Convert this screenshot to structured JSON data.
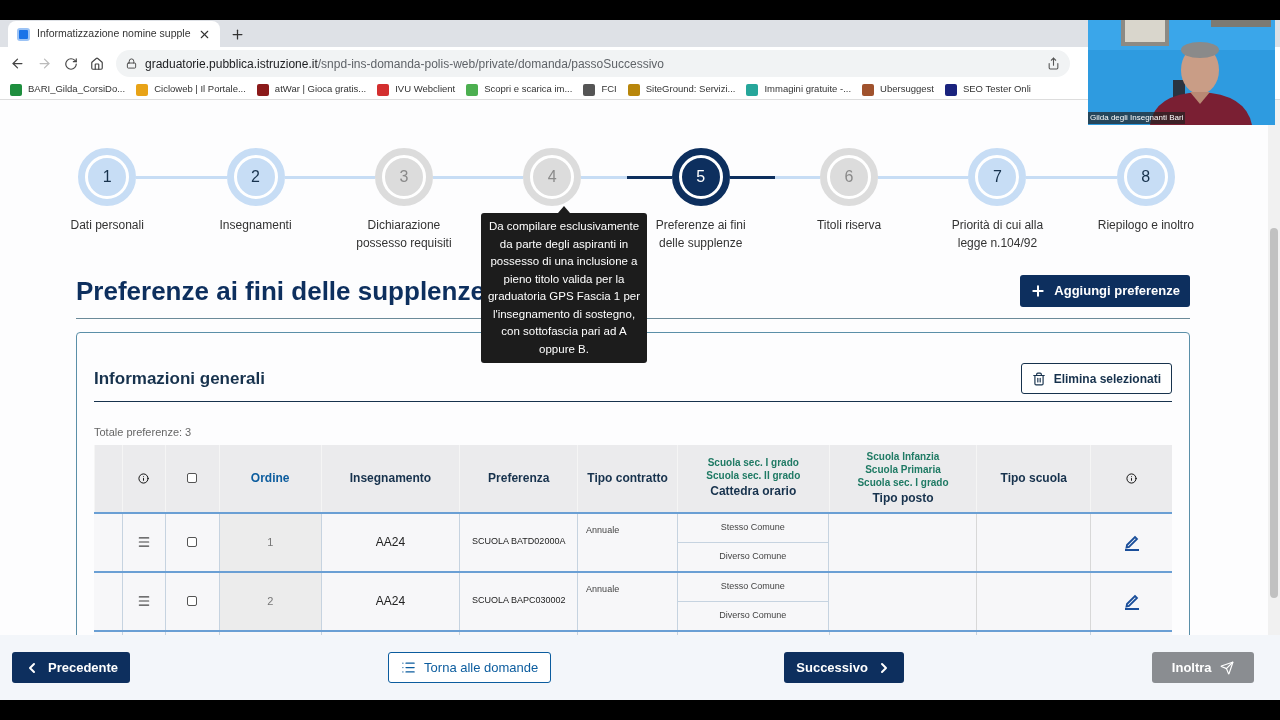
{
  "browser": {
    "tab": {
      "title": "Informatizzazione nomine supple"
    },
    "address": {
      "host": "graduatorie.pubblica.istruzione.it",
      "path": "/snpd-ins-domanda-polis-web/private/domanda/passoSuccessivo"
    },
    "bookmarks": [
      {
        "label": "BARI_Gilda_CorsiDo...",
        "color": "#1e8e3e"
      },
      {
        "label": "Cicloweb | Il Portale...",
        "color": "#e8a317"
      },
      {
        "label": "atWar | Gioca gratis...",
        "color": "#8b1a1a"
      },
      {
        "label": "IVU Webclient",
        "color": "#d32f2f"
      },
      {
        "label": "Scopri e scarica im...",
        "color": "#4caf50"
      },
      {
        "label": "FCI",
        "color": "#555555"
      },
      {
        "label": "SiteGround: Servizi...",
        "color": "#b8860b"
      },
      {
        "label": "Immagini gratuite -...",
        "color": "#26a69a"
      },
      {
        "label": "Ubersuggest",
        "color": "#a0522d"
      },
      {
        "label": "SEO Tester Onli",
        "color": "#1a237e"
      }
    ]
  },
  "webcam": {
    "caption": "Gilda degli Insegnanti Bari"
  },
  "stepper": [
    {
      "number": "1",
      "label": "Dati personali",
      "selected": false,
      "disabled": false
    },
    {
      "number": "2",
      "label": "Insegnamenti",
      "selected": false,
      "disabled": false
    },
    {
      "number": "3",
      "label": "Dichiarazione possesso requisiti",
      "selected": false,
      "disabled": true
    },
    {
      "number": "4",
      "selected": false,
      "disabled": true
    },
    {
      "number": "5",
      "label": "Preferenze ai fini delle supplenze",
      "selected": true,
      "disabled": false
    },
    {
      "number": "6",
      "label": "Titoli riserva",
      "selected": false,
      "disabled": true
    },
    {
      "number": "7",
      "label": "Priorità di cui alla legge n.104/92",
      "selected": false,
      "disabled": false
    },
    {
      "number": "8",
      "label": "Riepilogo e inoltro",
      "selected": false,
      "disabled": false
    }
  ],
  "tooltip": "Da compilare esclusivamente da parte degli aspiranti in possesso di una inclusione a pieno titolo valida per la graduatoria GPS Fascia 1 per l'insegnamento di sostegno, con sottofascia pari ad A oppure B.",
  "page_title": "Preferenze ai fini delle supplenze",
  "add_button": "Aggiungi preferenze",
  "card": {
    "title": "Informazioni generali",
    "delete_button": "Elimina selezionati",
    "total": "Totale preferenze: 3",
    "select_all": {
      "checked": false
    },
    "columns": [
      {
        "label": "Ordine",
        "kind": "link"
      },
      {
        "label": "Insegnamento",
        "kind": "plain"
      },
      {
        "label": "Preferenza",
        "kind": "plain"
      },
      {
        "label": "Tipo contratto",
        "kind": "plain"
      },
      {
        "label": "Cattedra orario",
        "kind": "plain",
        "notes": [
          "Scuola sec. I grado",
          "Scuola sec. II grado"
        ]
      },
      {
        "label": "Tipo posto",
        "kind": "plain",
        "notes": [
          "Scuola Infanzia",
          "Scuola Primaria",
          "Scuola sec. I grado"
        ]
      },
      {
        "label": "Tipo scuola",
        "kind": "plain"
      }
    ],
    "rows": [
      {
        "order": "1",
        "insegnamento": "AA24",
        "preferenza": "SCUOLA BATD02000A",
        "contratto": "Annuale",
        "cattedra": [
          "Stesso Comune",
          "Diverso Comune"
        ],
        "checked": false
      },
      {
        "order": "2",
        "insegnamento": "AA24",
        "preferenza": "SCUOLA BAPC030002",
        "contratto": "Annuale",
        "cattedra": [
          "Stesso Comune",
          "Diverso Comune"
        ],
        "checked": false
      }
    ]
  },
  "footer": [
    {
      "label": "Precedente",
      "kind": "prev",
      "disabled": false
    },
    {
      "label": "Torna alle domande",
      "kind": "back",
      "disabled": false
    },
    {
      "label": "Successivo",
      "kind": "next",
      "disabled": false
    },
    {
      "label": "Inoltra",
      "kind": "send",
      "disabled": true
    }
  ]
}
